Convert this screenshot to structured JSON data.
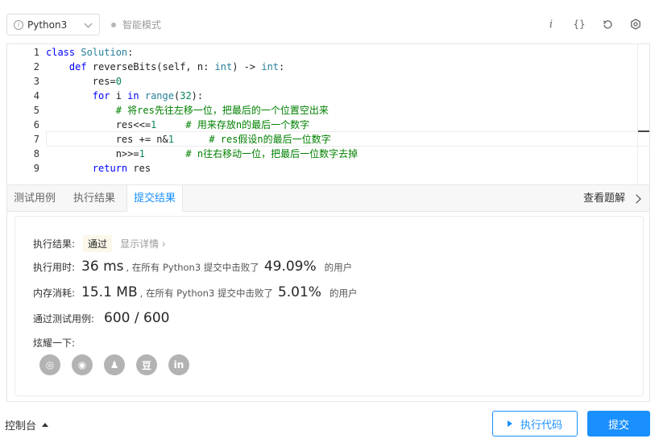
{
  "toolbar": {
    "language": "Python3",
    "mode": "智能模式",
    "icons": [
      "info-icon",
      "braces-icon",
      "reset-icon",
      "settings-icon"
    ]
  },
  "editor": {
    "line_numbers": [
      "1",
      "2",
      "3",
      "4",
      "5",
      "6",
      "7",
      "8",
      "9"
    ],
    "lines": [
      "class Solution:",
      "    def reverseBits(self, n: int) -> int:",
      "        res=0",
      "        for i in range(32):",
      "            # 将res先往左移一位，把最后的一个位置空出来",
      "            res<<=1     # 用来存放n的最后一个数字",
      "            res += n&1      # res假设n的最后一位数字",
      "            n>>=1       # n往右移动一位，把最后一位数字去掉",
      "        return res"
    ]
  },
  "tabs": {
    "test_case": "测试用例",
    "run_result": "执行结果",
    "submit_result": "提交结果",
    "view_solution": "查看题解"
  },
  "result": {
    "status_label": "执行结果:",
    "status": "通过",
    "detail": "显示详情 ›",
    "time_label": "执行用时:",
    "time_value": "36 ms",
    "time_text": ", 在所有 Python3 提交中击败了",
    "time_pct": "49.09%",
    "users_text": "的用户",
    "mem_label": "内存消耗:",
    "mem_value": "15.1 MB",
    "mem_text": ", 在所有 Python3 提交中击败了",
    "mem_pct": "5.01%",
    "tests_label": "通过测试用例:",
    "tests_value": "600 / 600",
    "share_label": "炫耀一下:",
    "share_icons": [
      "wechat-icon",
      "weibo-icon",
      "qq-icon",
      "douban-icon",
      "linkedin-icon"
    ],
    "share_glyphs": [
      "◎",
      "◉",
      "♟",
      "豆",
      "in"
    ]
  },
  "footer": {
    "console": "控制台",
    "run": "执行代码",
    "submit": "提交"
  },
  "colors": {
    "accent": "#1a90ff",
    "keyword": "#0000ff",
    "comment": "#008000"
  }
}
